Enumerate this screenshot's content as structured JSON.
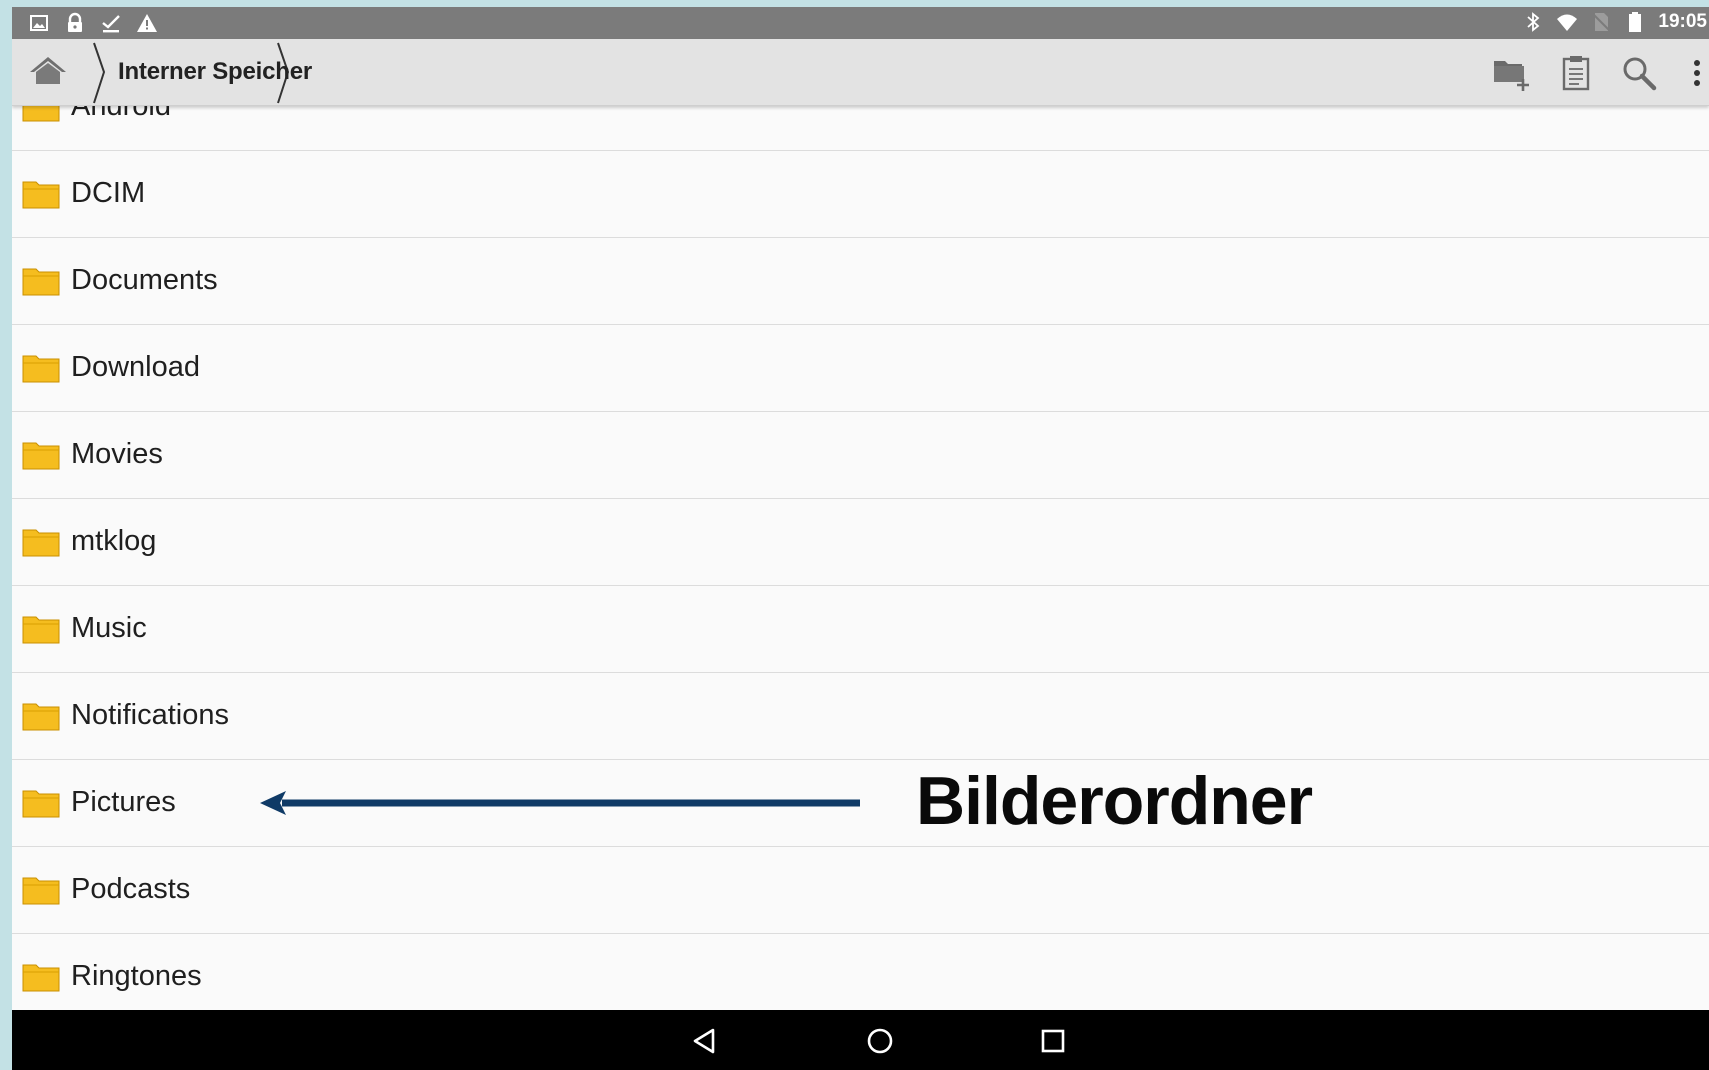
{
  "status_bar": {
    "time": "19:05",
    "left_icons": [
      "image-icon",
      "lock-icon",
      "checkmark-icon",
      "warning-icon"
    ],
    "right_icons": [
      "bluetooth-icon",
      "wifi-icon",
      "no-sim-icon",
      "battery-icon"
    ]
  },
  "toolbar": {
    "home_icon": "home-icon",
    "breadcrumb": "Interner Speicher",
    "actions": [
      "new-folder-icon",
      "clipboard-icon",
      "search-icon",
      "more-vert-icon"
    ]
  },
  "folders": [
    "Android",
    "DCIM",
    "Documents",
    "Download",
    "Movies",
    "mtklog",
    "Music",
    "Notifications",
    "Pictures",
    "Podcasts",
    "Ringtones"
  ],
  "annotation": {
    "label": "Bilderordner",
    "target": "Pictures",
    "arrow_color": "#0f3a66"
  },
  "nav_bar": {
    "buttons": [
      "back-icon",
      "home-circle-icon",
      "recents-icon"
    ]
  },
  "colors": {
    "status_bar": "#7b7b7b",
    "toolbar": "#e3e3e3",
    "folder": "#f5bd1f",
    "list_bg": "#fafafa"
  }
}
